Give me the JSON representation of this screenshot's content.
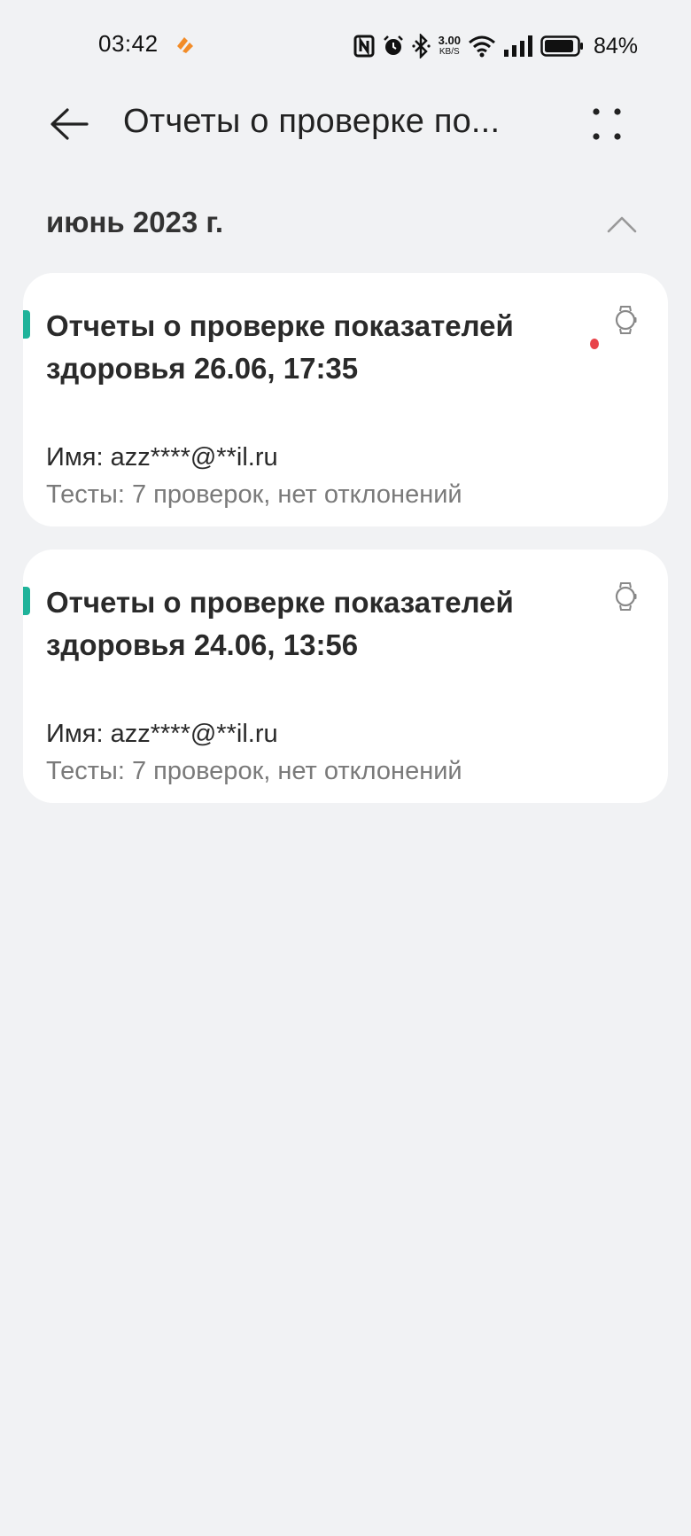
{
  "status_bar": {
    "time": "03:42",
    "net_speed_value": "3.00",
    "net_speed_unit": "KB/S",
    "battery_percent": "84%"
  },
  "header": {
    "title": "Отчеты о проверке по..."
  },
  "section": {
    "title": "июнь 2023 г."
  },
  "reports": [
    {
      "title_line1": "Отчеты о проверке показателей",
      "title_line2": "здоровья 26.06, 17:35",
      "name": "Имя: azz****@**il.ru",
      "tests": "Тесты: 7 проверок, нет отклонений",
      "unread": true,
      "device_icon": "watch-icon"
    },
    {
      "title_line1": "Отчеты о проверке показателей",
      "title_line2": "здоровья 24.06, 13:56",
      "name": "Имя: azz****@**il.ru",
      "tests": "Тесты: 7 проверок, нет отклонений",
      "unread": false,
      "device_icon": "watch-icon"
    }
  ],
  "colors": {
    "background": "#f1f2f4",
    "card": "#ffffff",
    "accent": "#1fb39a",
    "unread_dot": "#e8434a",
    "app_icon": "#f28c28"
  }
}
